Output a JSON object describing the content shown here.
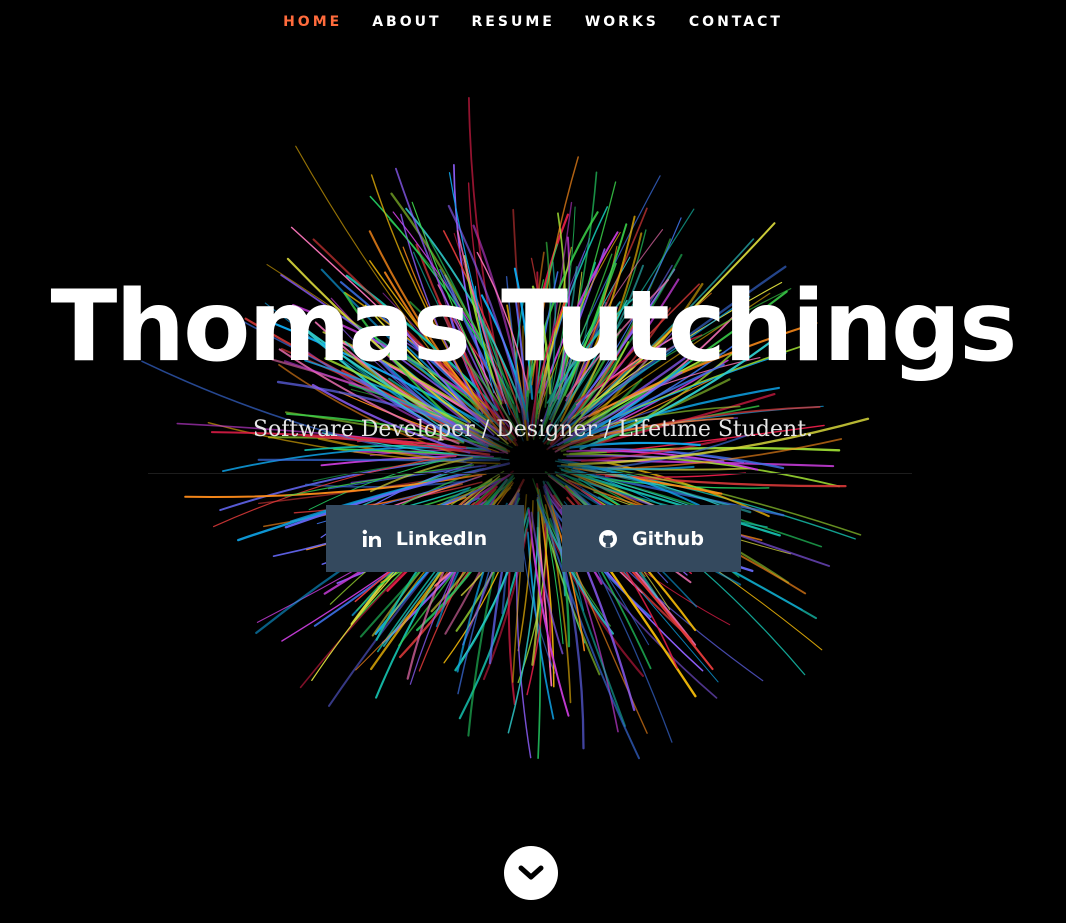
{
  "nav": {
    "items": [
      {
        "label": "HOME",
        "active": true
      },
      {
        "label": "ABOUT",
        "active": false
      },
      {
        "label": "RESUME",
        "active": false
      },
      {
        "label": "WORKS",
        "active": false
      },
      {
        "label": "CONTACT",
        "active": false
      }
    ],
    "active_color": "#ff6b3c"
  },
  "hero": {
    "title": "Thomas Tutchings",
    "subtitle": "Software Developer / Designer / Lifetime Student."
  },
  "social": {
    "linkedin": {
      "label": "LinkedIn",
      "icon": "linkedin-icon"
    },
    "github": {
      "label": "Github",
      "icon": "github-icon"
    },
    "button_color": "#34495e"
  },
  "scroll": {
    "icon": "chevron-down-icon"
  },
  "background": {
    "color": "#000000"
  }
}
